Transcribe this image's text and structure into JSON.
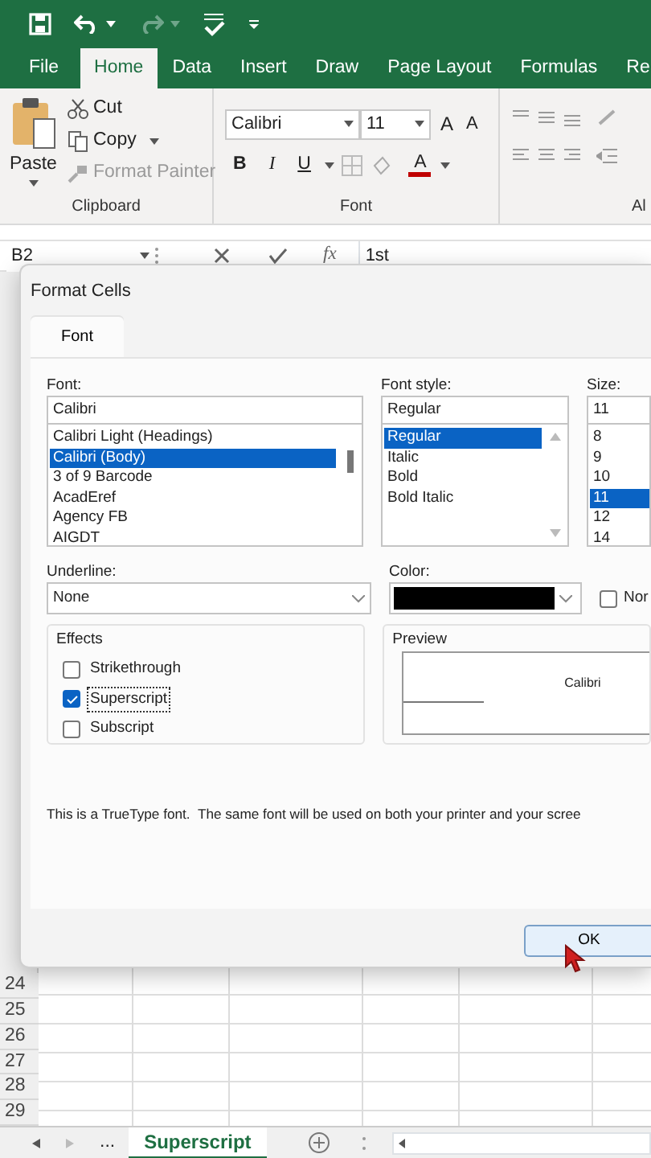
{
  "quick_access": {
    "undo_enabled": true,
    "redo_enabled": false
  },
  "ribbon_tabs": [
    {
      "label": "File",
      "selected": false
    },
    {
      "label": "Home",
      "selected": true
    },
    {
      "label": "Data",
      "selected": false
    },
    {
      "label": "Insert",
      "selected": false
    },
    {
      "label": "Draw",
      "selected": false
    },
    {
      "label": "Page Layout",
      "selected": false
    },
    {
      "label": "Formulas",
      "selected": false
    },
    {
      "label": "Re",
      "selected": false
    }
  ],
  "clipboard": {
    "paste": "Paste",
    "items": [
      {
        "label": "Cut",
        "kind": "cut",
        "disabled": false
      },
      {
        "label": "Copy",
        "kind": "copy",
        "disabled": false
      },
      {
        "label": "Format Painter",
        "kind": "painter",
        "disabled": true
      }
    ],
    "group_label": "Clipboard"
  },
  "font_group": {
    "font": "Calibri",
    "size": "11",
    "grow": "A",
    "shrink": "A",
    "bold": "B",
    "italic": "I",
    "underline": "U",
    "font_color": "A",
    "group_label": "Font"
  },
  "alignment_group": {
    "group_label": "Al"
  },
  "formula_bar": {
    "name_box": "B2",
    "fx": "fx",
    "value": "1st"
  },
  "dialog": {
    "title": "Format Cells",
    "tabs": [
      {
        "label": "Font",
        "selected": true
      }
    ],
    "font": {
      "label": "Font:",
      "value": "Calibri",
      "items": [
        {
          "label": "Calibri Light (Headings)",
          "selected": false
        },
        {
          "label": "Calibri (Body)",
          "selected": true
        },
        {
          "label": "3 of 9 Barcode",
          "selected": false
        },
        {
          "label": "AcadEref",
          "selected": false
        },
        {
          "label": "Agency FB",
          "selected": false
        },
        {
          "label": "AIGDT",
          "selected": false
        }
      ]
    },
    "font_style": {
      "label": "Font style:",
      "value": "Regular",
      "items": [
        {
          "label": "Regular",
          "selected": true
        },
        {
          "label": "Italic",
          "selected": false
        },
        {
          "label": "Bold",
          "selected": false
        },
        {
          "label": "Bold Italic",
          "selected": false
        }
      ]
    },
    "size": {
      "label": "Size:",
      "value": "11",
      "items": [
        {
          "label": "8",
          "selected": false
        },
        {
          "label": "9",
          "selected": false
        },
        {
          "label": "10",
          "selected": false
        },
        {
          "label": "11",
          "selected": true
        },
        {
          "label": "12",
          "selected": false
        },
        {
          "label": "14",
          "selected": false
        }
      ]
    },
    "underline": {
      "label": "Underline:",
      "value": "None"
    },
    "color": {
      "label": "Color:"
    },
    "normal_font": {
      "label": "Nor",
      "checked": false
    },
    "effects": {
      "label": "Effects",
      "items": [
        {
          "label": "Strikethrough",
          "checked": false
        },
        {
          "label": "Superscript",
          "checked": true
        },
        {
          "label": "Subscript",
          "checked": false
        }
      ]
    },
    "preview": {
      "label": "Preview",
      "sample": "Calibri"
    },
    "note": "This is a TrueType font.  The same font will be used on both your printer and your scree",
    "ok": "OK"
  },
  "rows": [
    "24",
    "25",
    "26",
    "27",
    "28",
    "29"
  ],
  "sheet_tabs": {
    "more": "...",
    "tabs": [
      {
        "label": "Superscript",
        "selected": true
      }
    ]
  }
}
